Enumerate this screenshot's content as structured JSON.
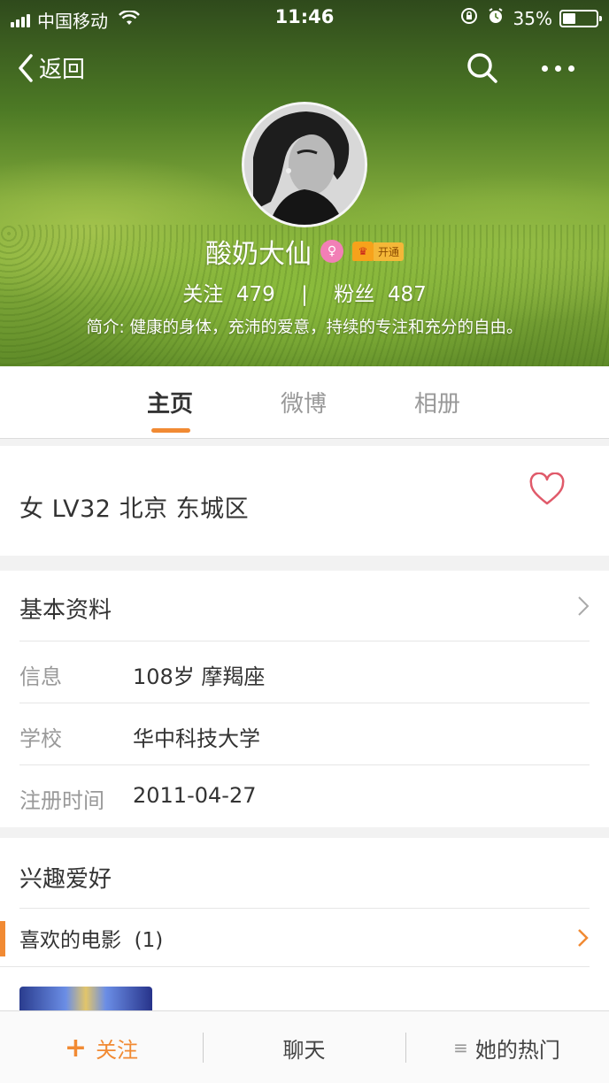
{
  "status_bar": {
    "carrier": "中国移动",
    "time": "11:46",
    "battery": "35%",
    "battery_level": 0.35
  },
  "nav": {
    "back_label": "返回",
    "icons": [
      "back-chevron-icon",
      "search-icon",
      "more-icon"
    ]
  },
  "profile": {
    "name": "酸奶大仙",
    "vip_label": "开通",
    "following_label": "关注",
    "following_count": "479",
    "separator": "|",
    "fans_label": "粉丝",
    "fans_count": "487",
    "bio": "简介: 健康的身体，充沛的爱意，持续的专注和充分的自由。"
  },
  "tabs": [
    {
      "label": "主页",
      "active": true
    },
    {
      "label": "微博",
      "active": false
    },
    {
      "label": "相册",
      "active": false
    }
  ],
  "summary": {
    "info": "女  LV32  北京 东城区"
  },
  "basic_info": {
    "title": "基本资料",
    "rows": [
      {
        "label": "信息",
        "value": "108岁  摩羯座"
      },
      {
        "label": "学校",
        "value": "华中科技大学"
      },
      {
        "label": "注册时间",
        "value": "2011-04-27"
      }
    ]
  },
  "interests": {
    "title": "兴趣爱好",
    "movies_label": "喜欢的电影",
    "movies_count": "(1)"
  },
  "bottom_bar": {
    "follow_label": "关注",
    "chat_label": "聊天",
    "hot_label": "她的热门"
  },
  "colors": {
    "accent": "#f18a33",
    "heart": "#e05a6a",
    "text": "#333333",
    "muted": "#999999"
  }
}
